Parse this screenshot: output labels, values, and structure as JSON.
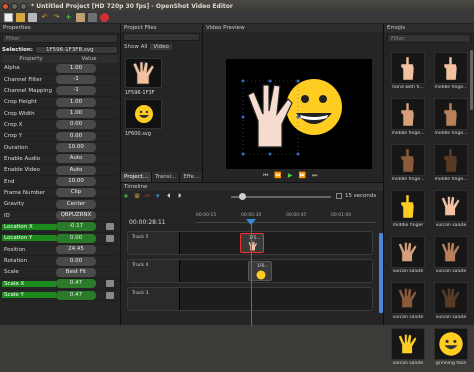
{
  "window": {
    "title": "* Untitled Project [HD 720p 30 fps] - OpenShot Video Editor"
  },
  "toolbar": {
    "icons": [
      "new-project-icon",
      "open-project-icon",
      "save-project-icon",
      "undo-icon",
      "redo-icon",
      "import-files-icon",
      "choose-profile-icon",
      "fullscreen-icon",
      "export-video-icon"
    ]
  },
  "properties": {
    "title": "Properties",
    "filter_placeholder": "Filter",
    "selection_label": "Selection:",
    "selection_value": "1F596-1F3FB.svg",
    "col_property": "Property",
    "col_value": "Value",
    "rows": [
      {
        "name": "Alpha",
        "value": "1.00",
        "green": false
      },
      {
        "name": "Channel Filter",
        "value": "-1",
        "green": false
      },
      {
        "name": "Channel Mapping",
        "value": "-1",
        "green": false
      },
      {
        "name": "Crop Height",
        "value": "1.00",
        "green": false
      },
      {
        "name": "Crop Width",
        "value": "1.00",
        "green": false
      },
      {
        "name": "Crop X",
        "value": "0.00",
        "green": false
      },
      {
        "name": "Crop Y",
        "value": "0.00",
        "green": false
      },
      {
        "name": "Duration",
        "value": "10.00",
        "green": false
      },
      {
        "name": "Enable Audio",
        "value": "Auto",
        "green": false
      },
      {
        "name": "Enable Video",
        "value": "Auto",
        "green": false
      },
      {
        "name": "End",
        "value": "10.00",
        "green": false
      },
      {
        "name": "Frame Number",
        "value": "Clip",
        "green": false
      },
      {
        "name": "Gravity",
        "value": "Center",
        "green": false
      },
      {
        "name": "ID",
        "value": "QBPUZRNX",
        "green": false
      },
      {
        "name": "Location X",
        "value": "-0.17",
        "green": true
      },
      {
        "name": "Location Y",
        "value": "0.00",
        "green": true
      },
      {
        "name": "Position",
        "value": "24.45",
        "green": false
      },
      {
        "name": "Rotation",
        "value": "0.00",
        "green": false
      },
      {
        "name": "Scale",
        "value": "Best Fit",
        "green": false
      },
      {
        "name": "Scale X",
        "value": "0.47",
        "green": true
      },
      {
        "name": "Scale Y",
        "value": "0.47",
        "green": true
      }
    ]
  },
  "project_files": {
    "title": "Project Files",
    "show_all": "Show All",
    "video": "Video",
    "files": [
      "1F596-1F3F",
      "1F600.svg"
    ],
    "tabs": [
      "Project...",
      "Transi...",
      "Effe..."
    ]
  },
  "video_preview": {
    "title": "Video Preview"
  },
  "emojis": {
    "title": "Emojis",
    "filter_placeholder": "Filter",
    "items": [
      {
        "label": "hand with fi...",
        "tone": "#f3c0a0"
      },
      {
        "label": "middle finge...",
        "tone": "#f3c0a0"
      },
      {
        "label": "middle finge...",
        "tone": "#d8a07a"
      },
      {
        "label": "middle finge...",
        "tone": "#b8805a"
      },
      {
        "label": "middle finge...",
        "tone": "#8a5a3a"
      },
      {
        "label": "middle finge...",
        "tone": "#5a3a22"
      },
      {
        "label": "middle finger",
        "tone": "#ffcc22"
      },
      {
        "label": "vulcan salute",
        "tone": "#f3c0a0"
      },
      {
        "label": "vulcan salute",
        "tone": "#d8a07a"
      },
      {
        "label": "vulcan salute",
        "tone": "#b8805a"
      },
      {
        "label": "vulcan salute",
        "tone": "#8a5a3a"
      },
      {
        "label": "vulcan salute",
        "tone": "#5a3a22"
      },
      {
        "label": "vulcan salute",
        "tone": "#ffcc22"
      },
      {
        "label": "grinning face",
        "tone": "#ffcc22"
      }
    ]
  },
  "timeline": {
    "title": "Timeline",
    "timecode": "00:00:28:11",
    "zoom_label": "15 seconds",
    "ticks": [
      "00:00:15",
      "00:00:30",
      "00:00:45",
      "00:01:00"
    ],
    "tracks": [
      {
        "name": "Track 5",
        "clip": "1F5..."
      },
      {
        "name": "Track 4",
        "clip": "1F6..."
      },
      {
        "name": "Track 3",
        "clip": ""
      }
    ]
  }
}
